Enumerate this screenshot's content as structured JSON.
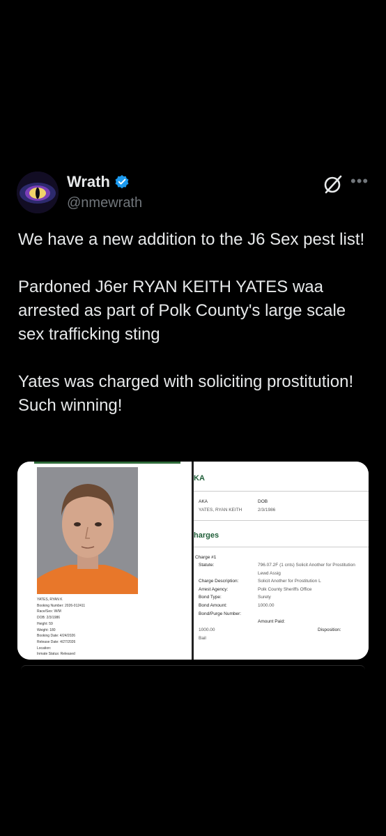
{
  "author": {
    "name": "Wrath",
    "handle": "@nmewrath",
    "verified_color": "#1d9bf0"
  },
  "tweet": {
    "paragraphs": [
      "We have a new addition to the J6 Sex pest list!",
      "Pardoned J6er RYAN KEITH YATES waa arrested as part of Polk County's large scale sex trafficking sting",
      "Yates was charged with soliciting prostitution! Such winning!"
    ]
  },
  "media": {
    "left": {
      "name": "YATES, RYAN K",
      "booking_number": "Booking Number: 2026-012411",
      "race_sex": "Race/Sex: W/M",
      "dob": "DOB: 2/3/1986",
      "height": "Height: 59",
      "weight": "Weight: 180",
      "booking_date": "Booking Date: 4/24/2026",
      "release_date": "Release Date: 4/27/2026",
      "location": "Location:",
      "inmate_status": "Inmate Status: Released"
    },
    "right": {
      "aka_head": "KA",
      "aka_label": "AKA",
      "dob_label": "DOB",
      "aka_value": "YATES, RYAN KEITH",
      "dob_value": "2/3/1986",
      "charges_head": "harges",
      "charge_num": "Charge #1",
      "statute_label": "Statute:",
      "statute_value": "796.07.2F (1 cnts) Solicit Another for Prostitution",
      "lewd": "Lewd Assig",
      "desc_label": "Charge Description:",
      "desc_value": "Solicit Another for Prostitution L",
      "agency_label": "Arrest Agency:",
      "agency_value": "Polk County Sheriffs Office",
      "bond_type_label": "Bond Type:",
      "bond_type_value": "Surety",
      "bond_amount_label": "Bond Amount:",
      "bond_amount_value": "1000.00",
      "purge_label": "Bond/Purge Number:",
      "paid_label": "Amount Paid:",
      "disposition_label": "Disposition:",
      "paid_value": "1000.00",
      "bail": "Bail"
    }
  }
}
